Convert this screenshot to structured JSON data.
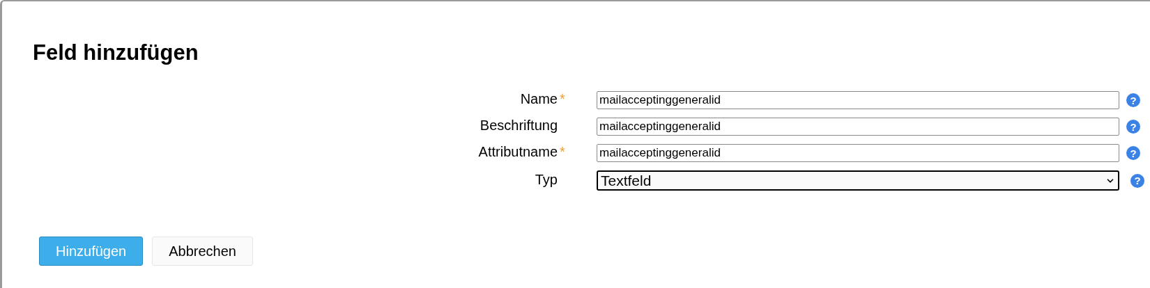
{
  "dialog": {
    "title": "Feld hinzufügen"
  },
  "required_mark": "*",
  "help_mark": "?",
  "fields": [
    {
      "label": "Name",
      "required": true,
      "kind": "text",
      "value": "mailacceptinggeneralid"
    },
    {
      "label": "Beschriftung",
      "required": false,
      "kind": "text",
      "value": "mailacceptinggeneralid"
    },
    {
      "label": "Attributname",
      "required": true,
      "kind": "text",
      "value": "mailacceptinggeneralid"
    },
    {
      "label": "Typ",
      "required": false,
      "kind": "select",
      "value": "Textfeld"
    }
  ],
  "buttons": [
    {
      "label": "Hinzufügen",
      "kind": "primary"
    },
    {
      "label": "Abbrechen",
      "kind": "secondary"
    }
  ]
}
